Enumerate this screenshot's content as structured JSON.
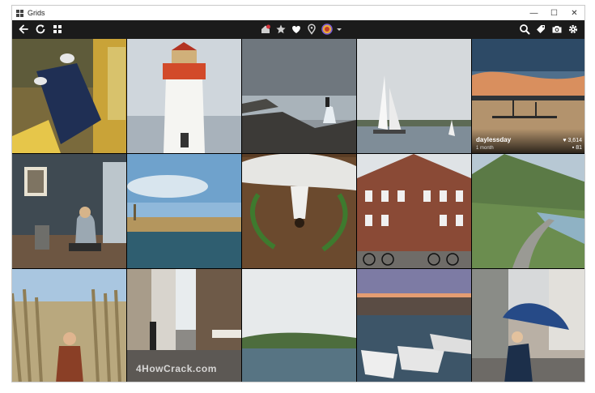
{
  "window": {
    "title": "Grids"
  },
  "controls": {
    "minimize": "—",
    "maximize": "☐",
    "close": "✕"
  },
  "toolbar": {
    "left": [
      "back-icon",
      "refresh-icon",
      "grid-view-icon"
    ],
    "center": [
      "home-icon",
      "star-icon",
      "heart-icon",
      "location-icon",
      "account-avatar",
      "dropdown-icon"
    ],
    "right": [
      "search-icon",
      "tag-icon",
      "camera-icon",
      "gear-icon"
    ],
    "accent": "#d4343d"
  },
  "feed": [
    {
      "id": "t1"
    },
    {
      "id": "t2"
    },
    {
      "id": "t3"
    },
    {
      "id": "t4"
    },
    {
      "id": "t5",
      "user": "daylessday",
      "time": "1 month",
      "likes": "3,614",
      "comments": "81"
    },
    {
      "id": "t6"
    },
    {
      "id": "t7"
    },
    {
      "id": "t8"
    },
    {
      "id": "t9"
    },
    {
      "id": "t10"
    },
    {
      "id": "t11"
    },
    {
      "id": "t12"
    },
    {
      "id": "t13"
    },
    {
      "id": "t14"
    },
    {
      "id": "t15"
    }
  ],
  "watermark": "4HowCrack.com"
}
